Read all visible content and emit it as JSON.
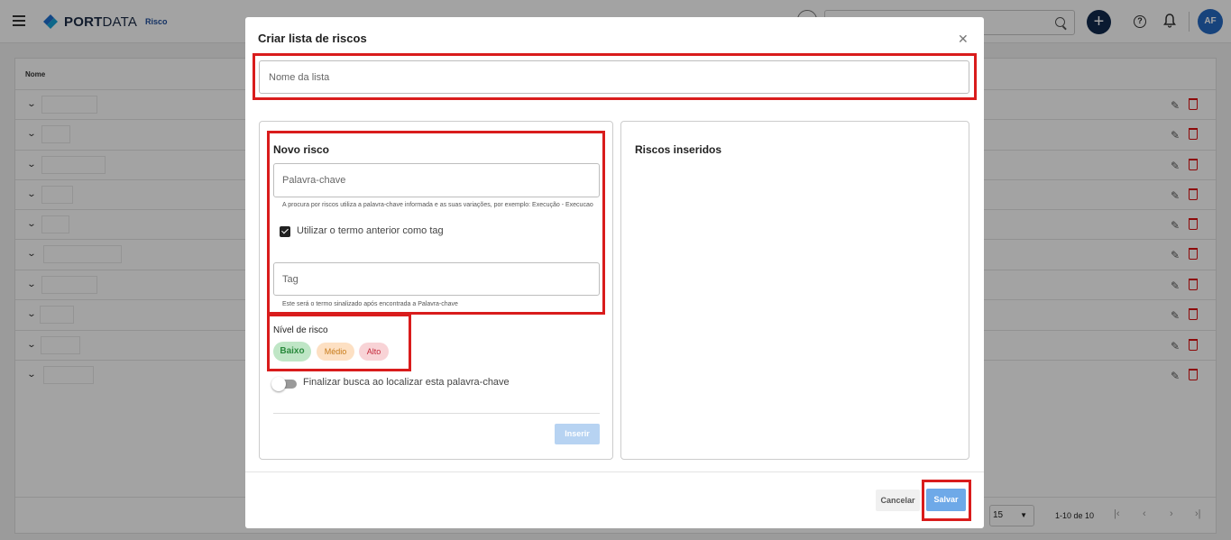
{
  "app": {
    "brand_bold": "PORT",
    "brand_light": "DATA",
    "module": "Risco",
    "user_initials": "AF"
  },
  "table": {
    "column_name": "Nome",
    "rows_count_label": "",
    "per_page": "15",
    "range_label": "1-10 de 10"
  },
  "modal": {
    "title": "Criar lista de riscos",
    "list_name_placeholder": "Nome da lista",
    "new_risk": {
      "title": "Novo risco",
      "keyword_placeholder": "Palavra-chave",
      "keyword_hint": "A procura por riscos utiliza a palavra-chave informada e as suas variações, por exemplo: Execução - Execucao",
      "use_as_tag_label": "Utilizar o termo anterior como tag",
      "use_as_tag_checked": true,
      "tag_placeholder": "Tag",
      "tag_hint": "Este será o termo sinalizado após encontrada a Palavra-chave"
    },
    "risk_level": {
      "title": "Nível de risco",
      "options": [
        "Baixo",
        "Médio",
        "Alto"
      ],
      "selected": "Baixo"
    },
    "stop_search_label": "Finalizar busca ao localizar esta palavra-chave",
    "insert_label": "Inserir",
    "inserted_title": "Riscos inseridos",
    "cancel_label": "Cancelar",
    "save_label": "Salvar"
  },
  "colors": {
    "highlight": "#d91c1c",
    "primary": "#6ea9e8",
    "navy": "#10294d"
  }
}
